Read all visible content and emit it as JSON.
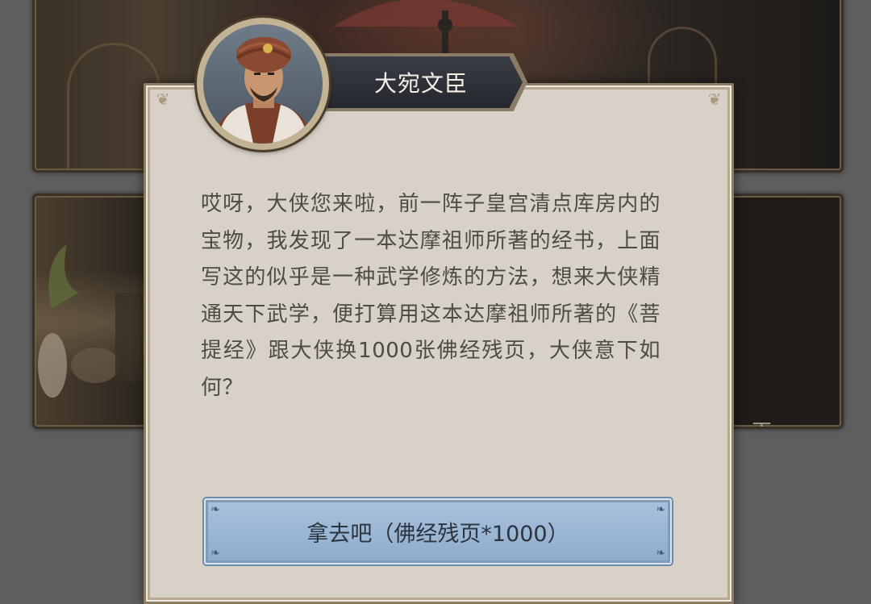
{
  "background": {
    "workshop_label": "工 坊"
  },
  "dialog": {
    "npc_name": "大宛文臣",
    "message": "哎呀，大侠您来啦，前一阵子皇宫清点库房内的宝物，我发现了一本达摩祖师所著的经书，上面写这的似乎是一种武学修炼的方法，想来大侠精通天下武学，便打算用这本达摩祖师所著的《菩提经》跟大侠换1000张佛经残页，大侠意下如何？",
    "accept_button_label": "拿去吧（佛经残页*1000）"
  },
  "colors": {
    "dialog_bg": "#d8d1c8",
    "button_bg": "#9cb8d4",
    "name_plate_bg": "#2f3139",
    "text": "#4f4a45"
  },
  "icons": {
    "portrait": "npc-portrait-turbaned-official",
    "corner": "scroll-corner-ornament"
  }
}
